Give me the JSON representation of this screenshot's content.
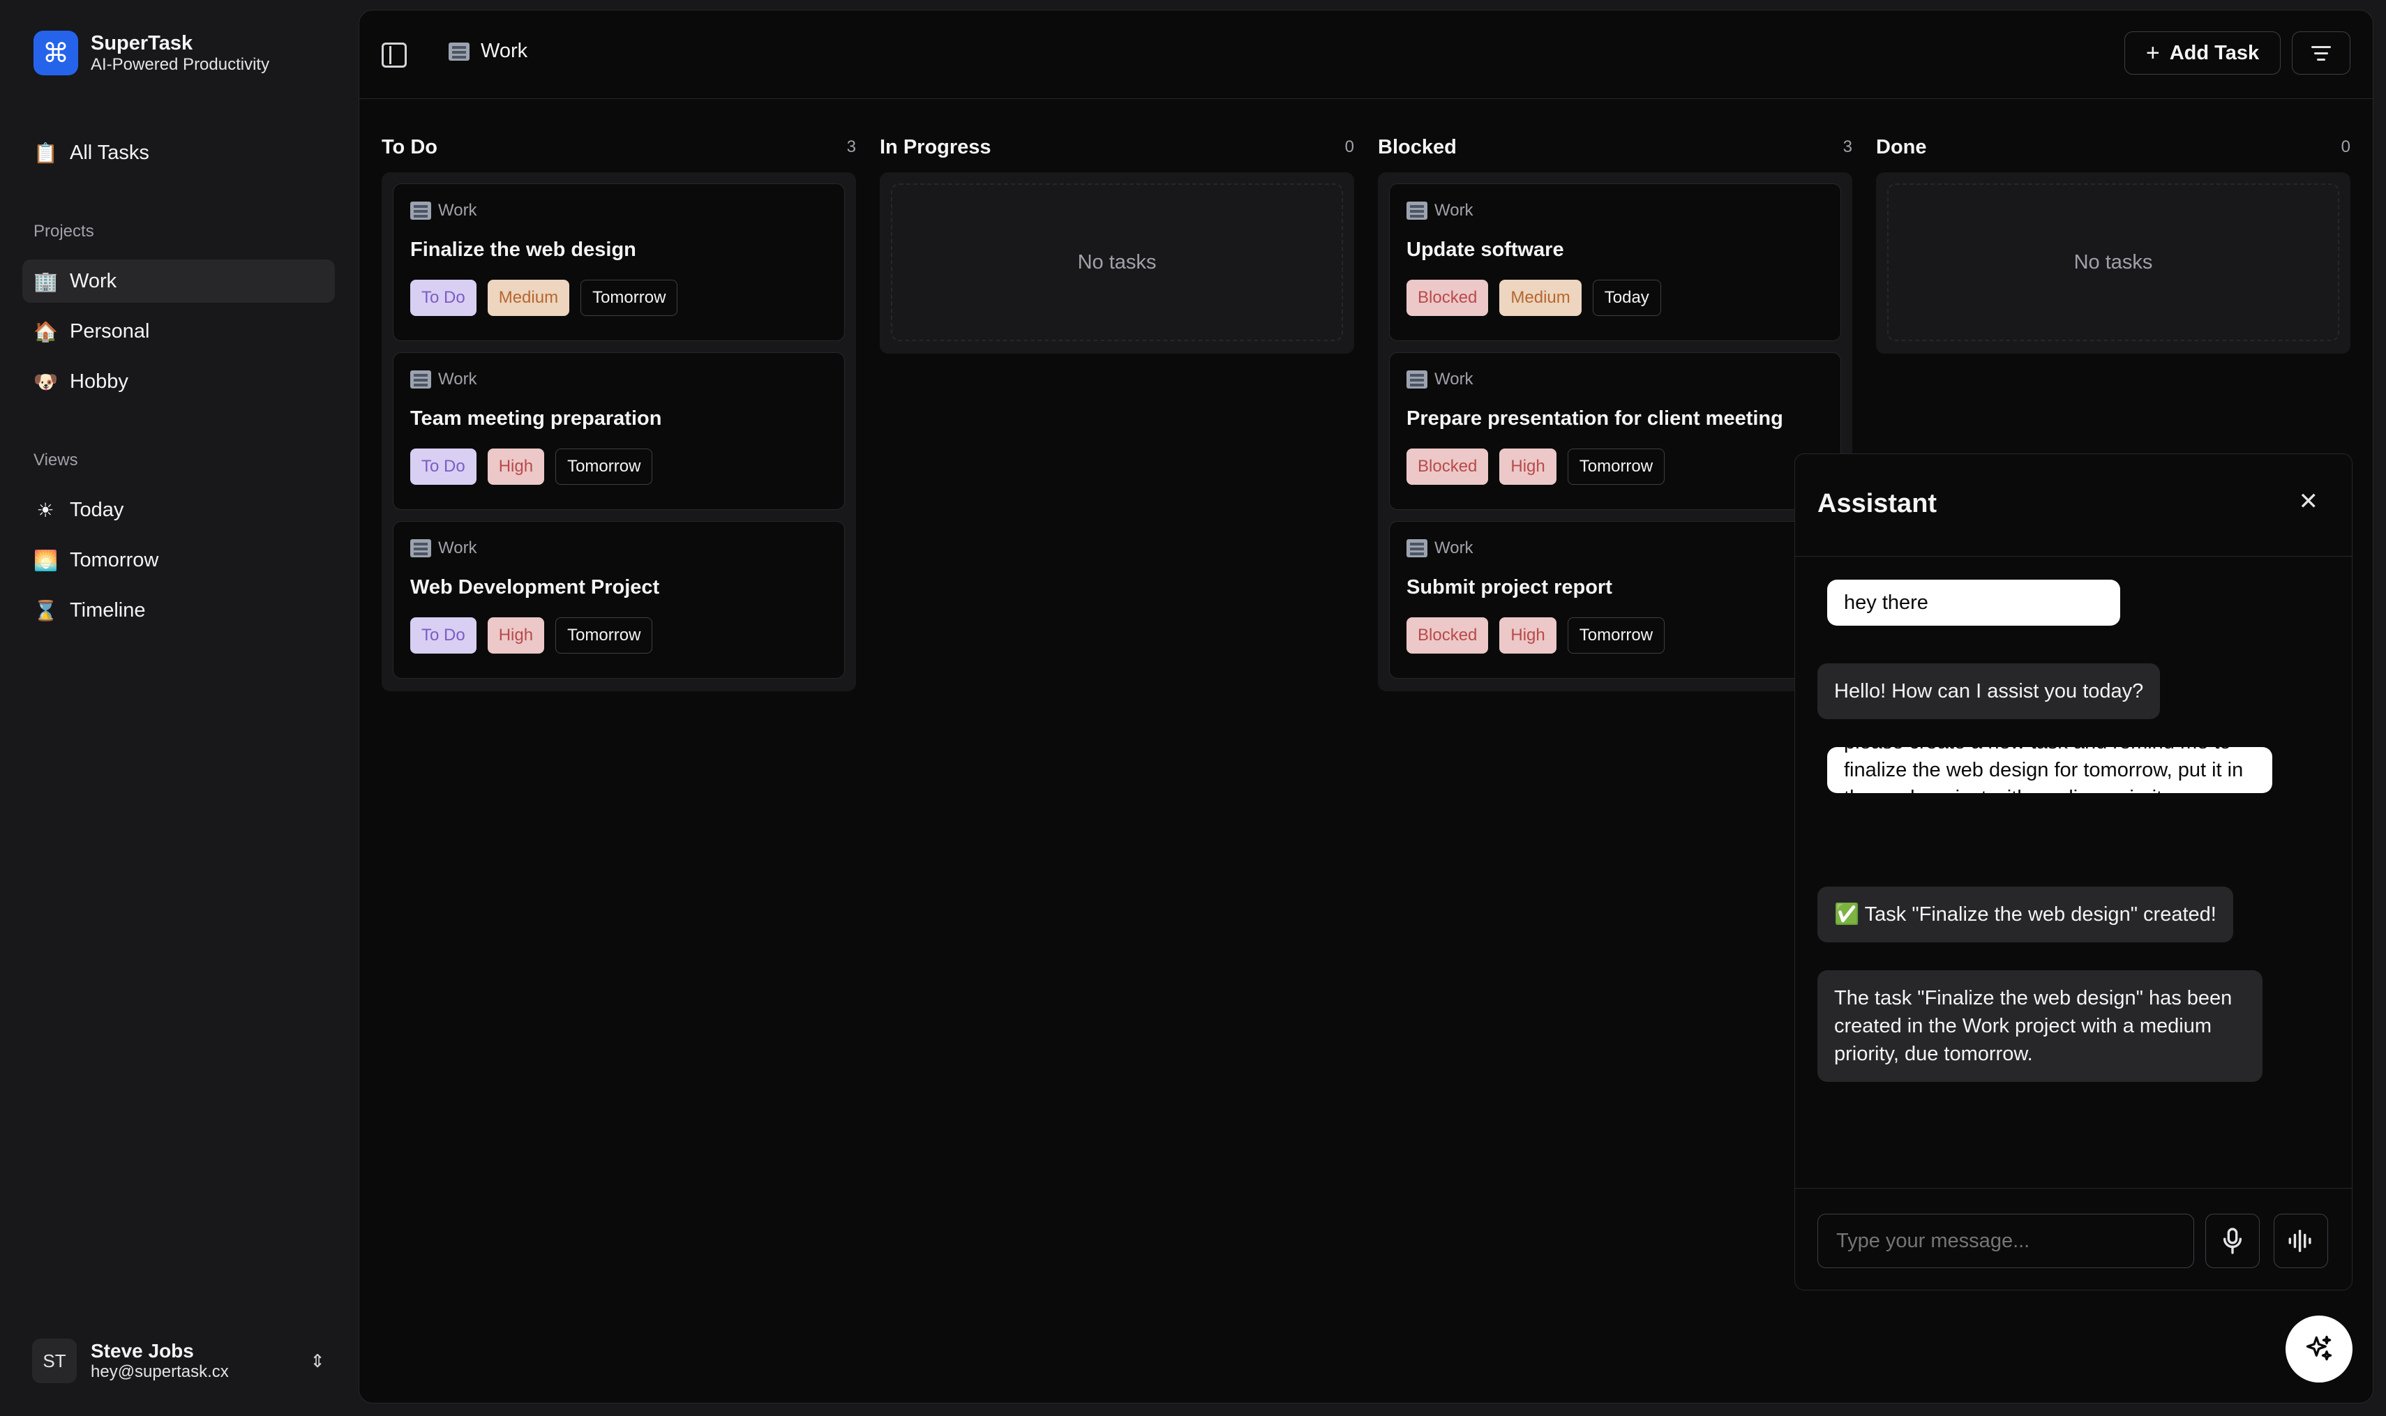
{
  "app": {
    "name": "SuperTask",
    "tagline": "AI-Powered Productivity",
    "logo_glyph": "⌘",
    "accent": "#2563eb"
  },
  "sidebar": {
    "all_tasks": {
      "label": "All Tasks",
      "icon": "clipboard-icon"
    },
    "projects_label": "Projects",
    "projects": [
      {
        "label": "Work",
        "icon": "office-building-icon",
        "active": true
      },
      {
        "label": "Personal",
        "icon": "house-icon"
      },
      {
        "label": "Hobby",
        "icon": "dog-face-icon"
      }
    ],
    "views_label": "Views",
    "views": [
      {
        "label": "Today",
        "icon": "sun-icon"
      },
      {
        "label": "Tomorrow",
        "icon": "sunrise-icon"
      },
      {
        "label": "Timeline",
        "icon": "hourglass-icon"
      }
    ],
    "user": {
      "initials": "ST",
      "name": "Steve Jobs",
      "email": "hey@supertask.cx"
    }
  },
  "header": {
    "breadcrumb": "Work",
    "add_task_label": "Add Task"
  },
  "board": {
    "empty_text": "No tasks",
    "columns": [
      {
        "title": "To Do",
        "count": "3",
        "cards": [
          {
            "project": "Work",
            "title": "Finalize the web design",
            "status": "To Do",
            "priority": "Medium",
            "due": "Tomorrow"
          },
          {
            "project": "Work",
            "title": "Team meeting preparation",
            "status": "To Do",
            "priority": "High",
            "due": "Tomorrow"
          },
          {
            "project": "Work",
            "title": "Web Development Project",
            "status": "To Do",
            "priority": "High",
            "due": "Tomorrow"
          }
        ]
      },
      {
        "title": "In Progress",
        "count": "0",
        "cards": []
      },
      {
        "title": "Blocked",
        "count": "3",
        "cards": [
          {
            "project": "Work",
            "title": "Update software",
            "status": "Blocked",
            "priority": "Medium",
            "due": "Today"
          },
          {
            "project": "Work",
            "title": "Prepare presentation for client meeting",
            "status": "Blocked",
            "priority": "High",
            "due": "Tomorrow"
          },
          {
            "project": "Work",
            "title": "Submit project report",
            "status": "Blocked",
            "priority": "High",
            "due": "Tomorrow"
          }
        ]
      },
      {
        "title": "Done",
        "count": "0",
        "cards": []
      }
    ]
  },
  "assistant": {
    "title": "Assistant",
    "messages": [
      {
        "role": "user",
        "text": "hey there"
      },
      {
        "role": "assistant",
        "text": "Hello! How can I assist you today?"
      },
      {
        "role": "user",
        "text": "please create a new task and remind me to finalize the web design for tomorrow, put it in the work project with medium priority"
      },
      {
        "role": "assistant",
        "text": "✅ Task \"Finalize the web design\" created!"
      },
      {
        "role": "assistant",
        "text": "The task \"Finalize the web design\" has been created in the Work project with a medium priority, due tomorrow."
      }
    ],
    "input_placeholder": "Type your message...",
    "icons": [
      "microphone-icon",
      "audio-wave-icon",
      "sparkles-icon"
    ]
  }
}
